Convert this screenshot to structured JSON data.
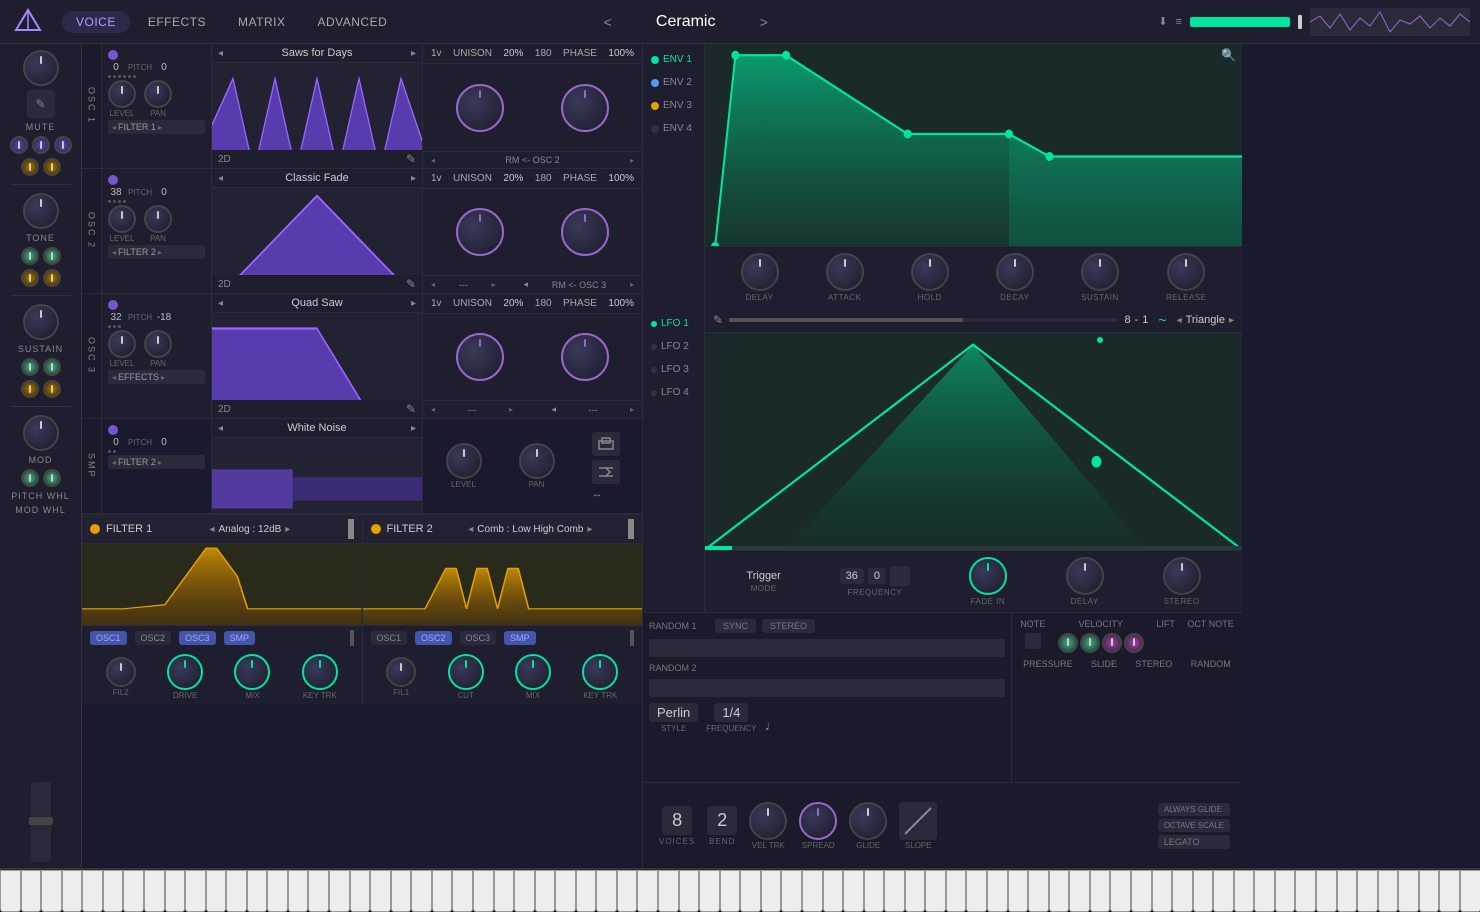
{
  "header": {
    "logo": "V",
    "tabs": [
      "VOICE",
      "EFFECTS",
      "MATRIX",
      "ADVANCED"
    ],
    "active_tab": "VOICE",
    "preset_prev": "<",
    "preset_next": ">",
    "preset_name": "Ceramic"
  },
  "sidebar": {
    "mute_label": "MUTE",
    "tone_label": "TONE",
    "sustain_label": "SUSTAIN",
    "mod_label": "MOD",
    "pitch_whl_label": "PITCH WHL",
    "mod_whl_label": "MOD WHL"
  },
  "osc1": {
    "label": "OSC 1",
    "enabled": true,
    "pitch_left": "0",
    "pitch_right": "0",
    "pitch_label": "PITCH",
    "wave_name": "Saws for Days",
    "unison_v": "1v",
    "unison_pct": "20%",
    "phase_deg": "180",
    "phase_pct": "100%",
    "filter": "FILTER 1",
    "dim": "2D",
    "rm_label": "RM <- OSC 2"
  },
  "osc2": {
    "label": "OSC 2",
    "enabled": true,
    "pitch_left": "38",
    "pitch_right": "0",
    "pitch_label": "PITCH",
    "wave_name": "Classic Fade",
    "filter": "FILTER 2",
    "dim": "2D",
    "rm_label": "RM <- OSC 3"
  },
  "osc3": {
    "label": "OSC 3",
    "enabled": true,
    "pitch_left": "32",
    "pitch_right": "-18",
    "pitch_label": "PITCH",
    "wave_name": "Quad Saw",
    "filter": "EFFECTS",
    "dim": "2D",
    "rm_label": "---"
  },
  "smp": {
    "label": "SMP",
    "enabled": true,
    "pitch_left": "0",
    "pitch_right": "0",
    "wave_name": "White Noise",
    "filter": "FILTER 2",
    "level_label": "LEVEL",
    "pan_label": "PAN"
  },
  "filter1": {
    "enabled": true,
    "name": "FILTER 1",
    "preset": "Analog : 12dB",
    "osc1": "OSC1",
    "osc2": "OSC2",
    "osc3": "OSC3",
    "smp": "SMP",
    "fil_label": "FIL2",
    "drive_label": "DRIVE",
    "mix_label": "MIX",
    "key_trk_label": "KEY TRK"
  },
  "filter2": {
    "enabled": true,
    "name": "FILTER 2",
    "preset": "Comb : Low High Comb",
    "osc1": "OSC1",
    "osc2": "OSC2",
    "osc3": "OSC3",
    "smp": "SMP",
    "fil_label": "FIL1",
    "cut_label": "CUT",
    "mix_label": "MIX",
    "key_trk_label": "KEY TRK"
  },
  "env": {
    "tabs": [
      "ENV 1",
      "ENV 2",
      "ENV 3",
      "ENV 4"
    ],
    "active": "ENV 1",
    "delay_label": "DELAY",
    "attack_label": "ATTACK",
    "hold_label": "HOLD",
    "decay_label": "DECAY",
    "sustain_label": "SUSTAIN",
    "release_label": "RELEASE"
  },
  "lfo": {
    "tabs": [
      "LFO 1",
      "LFO 2",
      "LFO 3",
      "LFO 4"
    ],
    "active": "LFO 1",
    "rate_num": "8",
    "rate_dash": "-",
    "rate_sub": "1",
    "shape": "Triangle",
    "trigger_label": "Trigger",
    "mode_label": "MODE",
    "freq_val1": "36",
    "freq_val2": "0",
    "frequency_label": "FREQUENCY",
    "fade_in_label": "FADE IN",
    "delay_label": "DELAY",
    "stereo_label": "STEREO"
  },
  "random": {
    "rand1_label": "RANDOM 1",
    "rand2_label": "RANDOM 2",
    "sync_label": "SYNC",
    "stereo_label": "STEREO",
    "style_val": "Perlin",
    "style_label": "STYLE",
    "freq_val": "1/4",
    "freq_label": "FREQUENCY",
    "note_label": "NOTE",
    "velocity_label": "VELOCITY",
    "lift_label": "LIFT",
    "oct_note_label": "OCT NOTE",
    "pressure_label": "PRESSURE",
    "slide_label": "SLIDE",
    "stereo_label2": "STEREO",
    "random_label": "RANDOM"
  },
  "voice_bottom": {
    "voices_val": "8",
    "voices_label": "VOICES",
    "bend_val": "2",
    "bend_label": "BEND",
    "vel_trk_label": "VEL TRK",
    "spread_label": "SPREAD",
    "glide_label": "GLIDE",
    "slope_label": "SLOPE",
    "always_glide": "ALWAYS GLIDE",
    "octave_scale": "OCTAVE SCALE",
    "legato": "LEGATO"
  }
}
